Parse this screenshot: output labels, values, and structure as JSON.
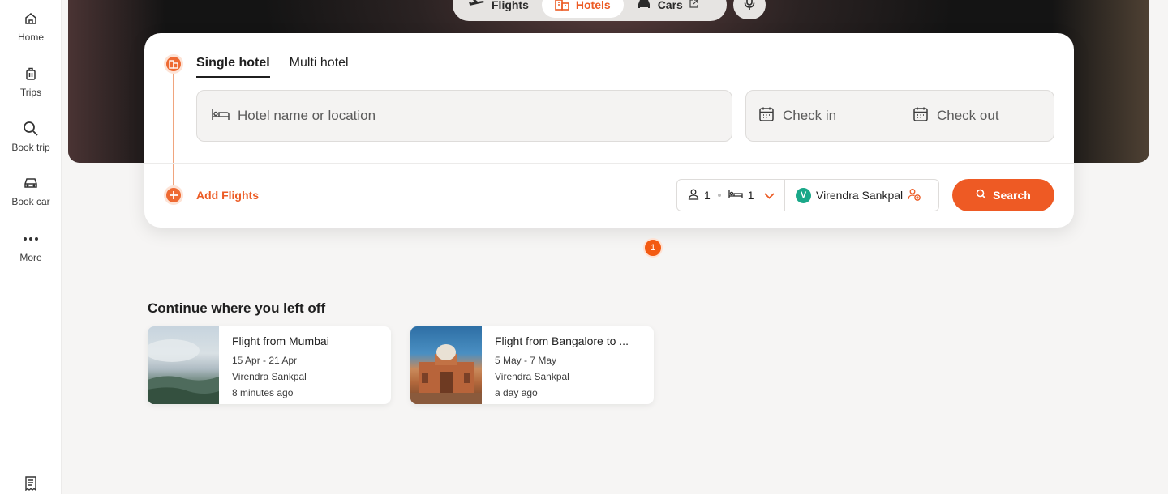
{
  "sidebar": {
    "items": [
      {
        "label": "Home",
        "icon": "home-icon"
      },
      {
        "label": "Trips",
        "icon": "luggage-icon"
      },
      {
        "label": "Book trip",
        "icon": "search-icon"
      },
      {
        "label": "Book car",
        "icon": "car-icon"
      },
      {
        "label": "More",
        "icon": "more-icon"
      }
    ],
    "bottom_icon": "receipt-icon"
  },
  "mode_tabs": [
    {
      "label": "Flights",
      "icon": "plane-icon",
      "active": false
    },
    {
      "label": "Hotels",
      "icon": "hotel-icon",
      "active": true
    },
    {
      "label": "Cars",
      "icon": "car-icon",
      "active": false,
      "external": true
    }
  ],
  "mic_icon": "microphone-icon",
  "search_card": {
    "sub_tabs": [
      {
        "label": "Single hotel",
        "active": true
      },
      {
        "label": "Multi hotel",
        "active": false
      }
    ],
    "hotel_field": {
      "placeholder": "Hotel name or location",
      "icon": "bed-icon"
    },
    "checkin": {
      "placeholder": "Check in",
      "icon": "calendar-icon"
    },
    "checkout": {
      "placeholder": "Check out",
      "icon": "calendar-icon"
    },
    "add_flights_label": "Add Flights",
    "guests": {
      "count": "1",
      "rooms": "1"
    },
    "traveler": {
      "initial": "V",
      "name": "Virendra Sankpal"
    },
    "search_label": "Search"
  },
  "notification_badge": "1",
  "continue_section": {
    "title": "Continue where you left off",
    "items": [
      {
        "title": "Flight from Mumbai",
        "dates": "15 Apr - 21 Apr",
        "traveler": "Virendra Sankpal",
        "time": "8 minutes ago"
      },
      {
        "title": "Flight from Bangalore to ...",
        "dates": "5 May - 7 May",
        "traveler": "Virendra Sankpal",
        "time": "a day ago"
      }
    ]
  },
  "colors": {
    "accent": "#ee5a24",
    "brand_teal": "#1aa889",
    "background": "#f6f5f4"
  }
}
